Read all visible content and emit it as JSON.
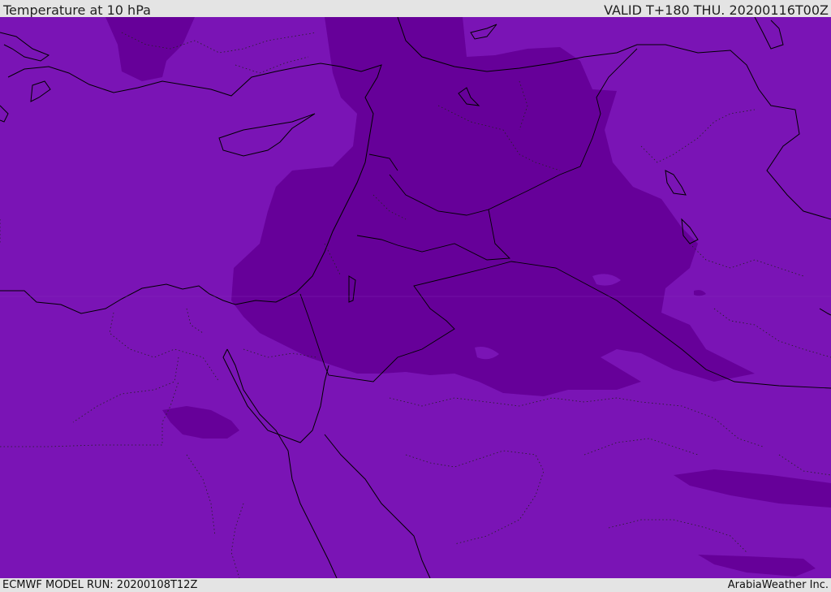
{
  "header": {
    "title": "Temperature at 10 hPa",
    "valid": "VALID T+180 THU. 20200116T00Z"
  },
  "footer": {
    "model_run": "ECMWF MODEL RUN: 20200108T12Z",
    "brand": "ArabiaWeather Inc."
  },
  "colors": {
    "field_light": "#7a14b5",
    "field_dark": "#660099",
    "border_line": "#000000",
    "bar_background": "#e4e4e4"
  }
}
